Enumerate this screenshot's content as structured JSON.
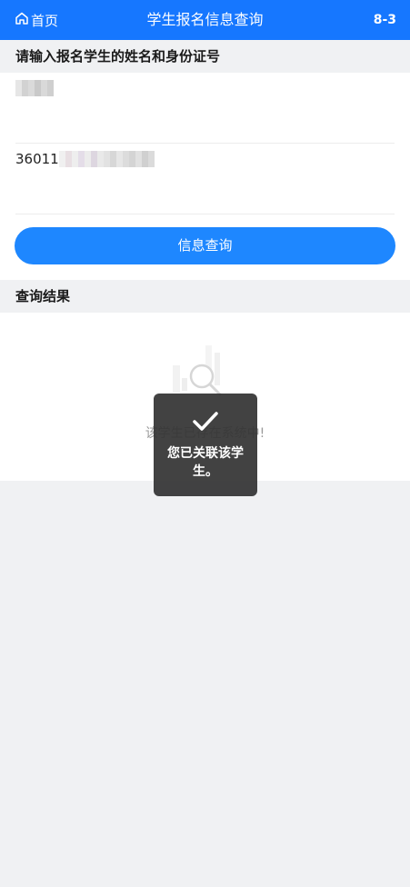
{
  "header": {
    "home_label": "首页",
    "title": "学生报名信息查询",
    "version": "8-3",
    "background_color": "#1677ff"
  },
  "form": {
    "section_title": "请输入报名学生的姓名和身份证号",
    "name_field": {
      "value": "",
      "note": "obscured"
    },
    "id_field": {
      "value_prefix": "36011"
    },
    "submit_label": "信息查询",
    "submit_color": "#1e87ff"
  },
  "results": {
    "section_title": "查询结果",
    "empty_message": "该学生已存在系统中!"
  },
  "toast": {
    "icon": "checkmark-icon",
    "message": "您已关联该学生。"
  }
}
